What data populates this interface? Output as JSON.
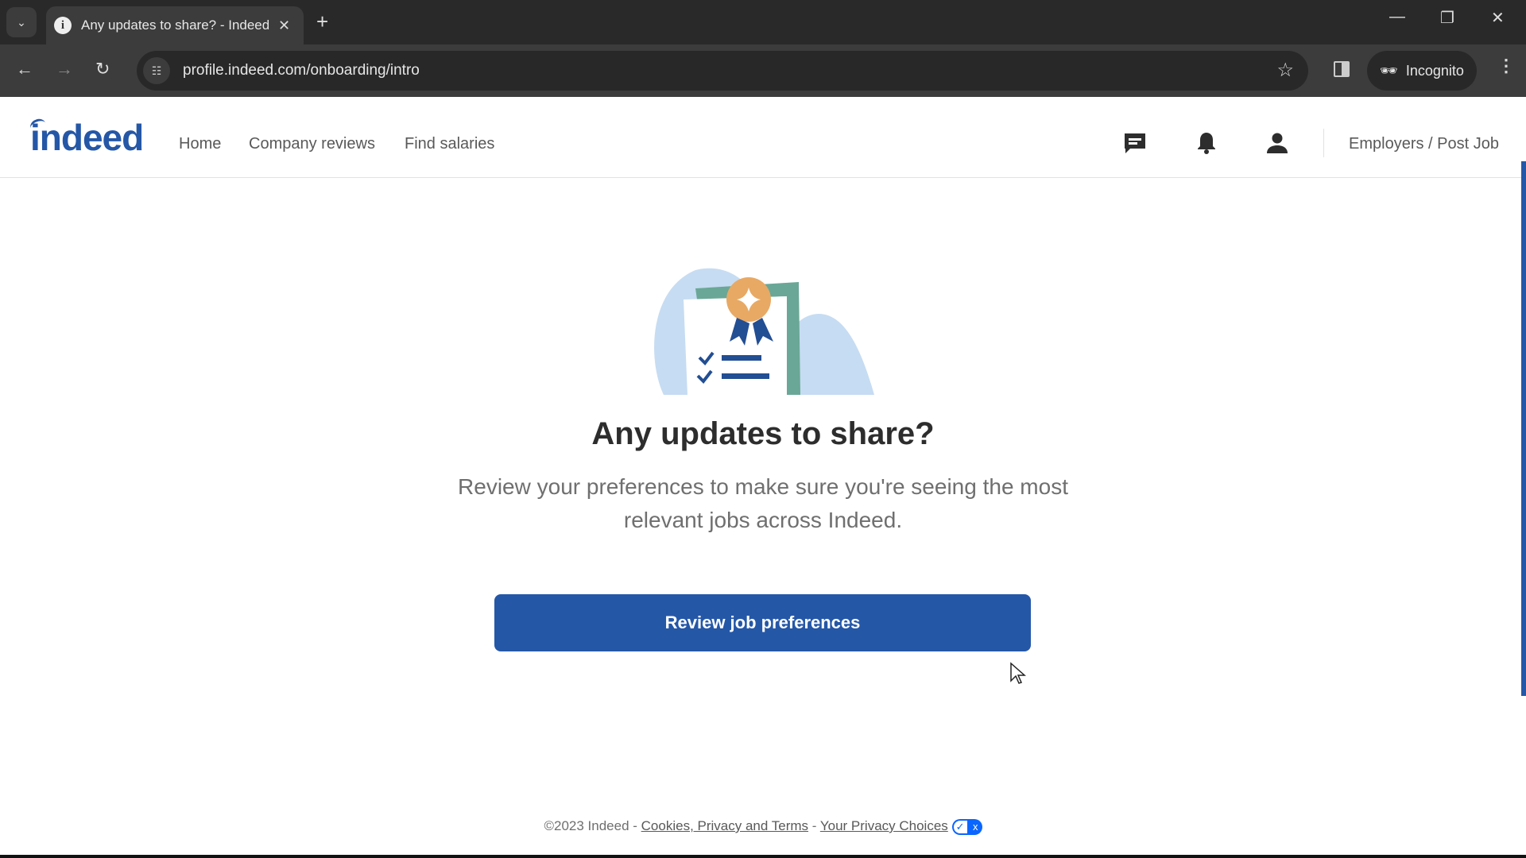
{
  "browser": {
    "tab_title": "Any updates to share? - Indeed",
    "url": "profile.indeed.com/onboarding/intro",
    "incognito_label": "Incognito"
  },
  "header": {
    "logo": "indeed",
    "nav": [
      {
        "label": "Home"
      },
      {
        "label": "Company reviews"
      },
      {
        "label": "Find salaries"
      }
    ],
    "employers_label": "Employers / Post Job"
  },
  "main": {
    "title": "Any updates to share?",
    "description": "Review your preferences to make sure you're seeing the most relevant jobs across Indeed.",
    "cta_label": "Review job preferences"
  },
  "footer": {
    "copyright": "©2023 Indeed",
    "sep": " - ",
    "cookies_link": "Cookies, Privacy and Terms",
    "privacy_link": "Your Privacy Choices"
  },
  "colors": {
    "brand": "#2557a7",
    "browser_dark": "#292929",
    "badge": "#0a66ff"
  }
}
